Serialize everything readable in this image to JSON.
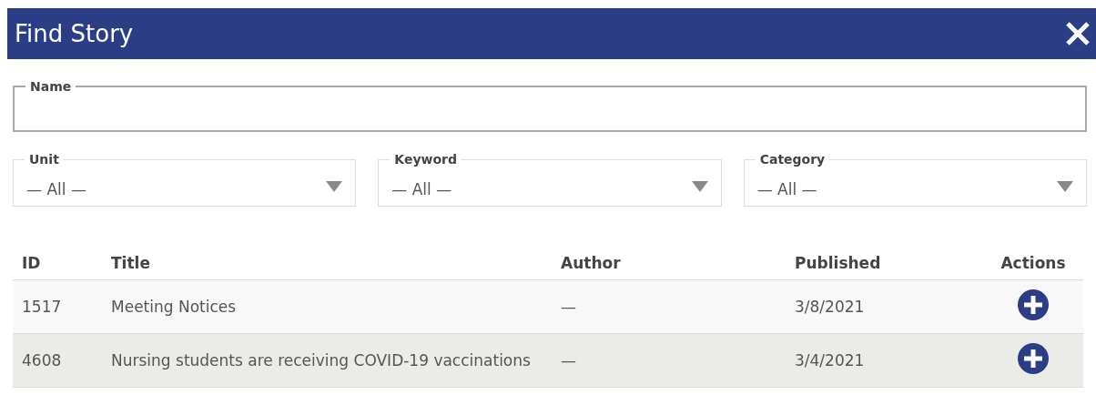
{
  "window": {
    "title": "Find Story"
  },
  "name_field": {
    "label": "Name"
  },
  "filters": [
    {
      "label": "Unit",
      "value": "— All —"
    },
    {
      "label": "Keyword",
      "value": "— All —"
    },
    {
      "label": "Category",
      "value": "— All —"
    }
  ],
  "table": {
    "columns": [
      "ID",
      "Title",
      "Author",
      "Published",
      "Actions"
    ],
    "rows": [
      {
        "id": "1517",
        "title": "Meeting Notices",
        "author": "—",
        "published": "3/8/2021",
        "selected": false
      },
      {
        "id": "4608",
        "title": "Nursing students are receiving COVID-19 vaccinations",
        "author": "—",
        "published": "3/4/2021",
        "selected": true
      }
    ]
  }
}
